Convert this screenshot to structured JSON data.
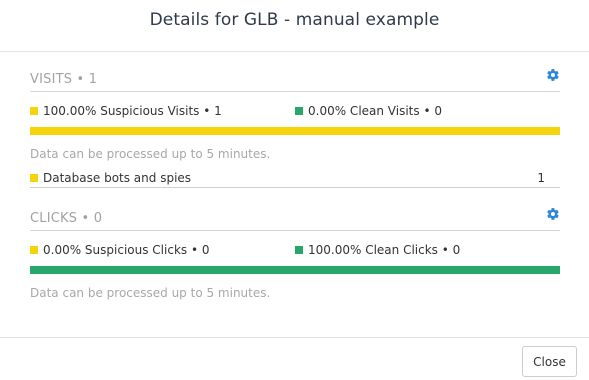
{
  "dialog": {
    "title": "Details for GLB - manual example"
  },
  "colors": {
    "suspicious": "#f5d40c",
    "clean": "#27a86a"
  },
  "visits": {
    "title": "VISITS • 1",
    "settings_icon": "gear-icon",
    "suspicious_label": "100.00% Suspicious Visits • 1",
    "clean_label": "0.00% Clean Visits • 0",
    "suspicious_fraction": 1.0,
    "note": "Data can be processed up to 5 minutes.",
    "rows": [
      {
        "label": "Database bots and spies",
        "value": "1"
      }
    ]
  },
  "clicks": {
    "title": "CLICKS • 0",
    "settings_icon": "gear-icon",
    "suspicious_label": "0.00% Suspicious Clicks • 0",
    "clean_label": "100.00% Clean Clicks • 0",
    "suspicious_fraction": 0.0,
    "note": "Data can be processed up to 5 minutes."
  },
  "footer": {
    "close_label": "Close"
  }
}
